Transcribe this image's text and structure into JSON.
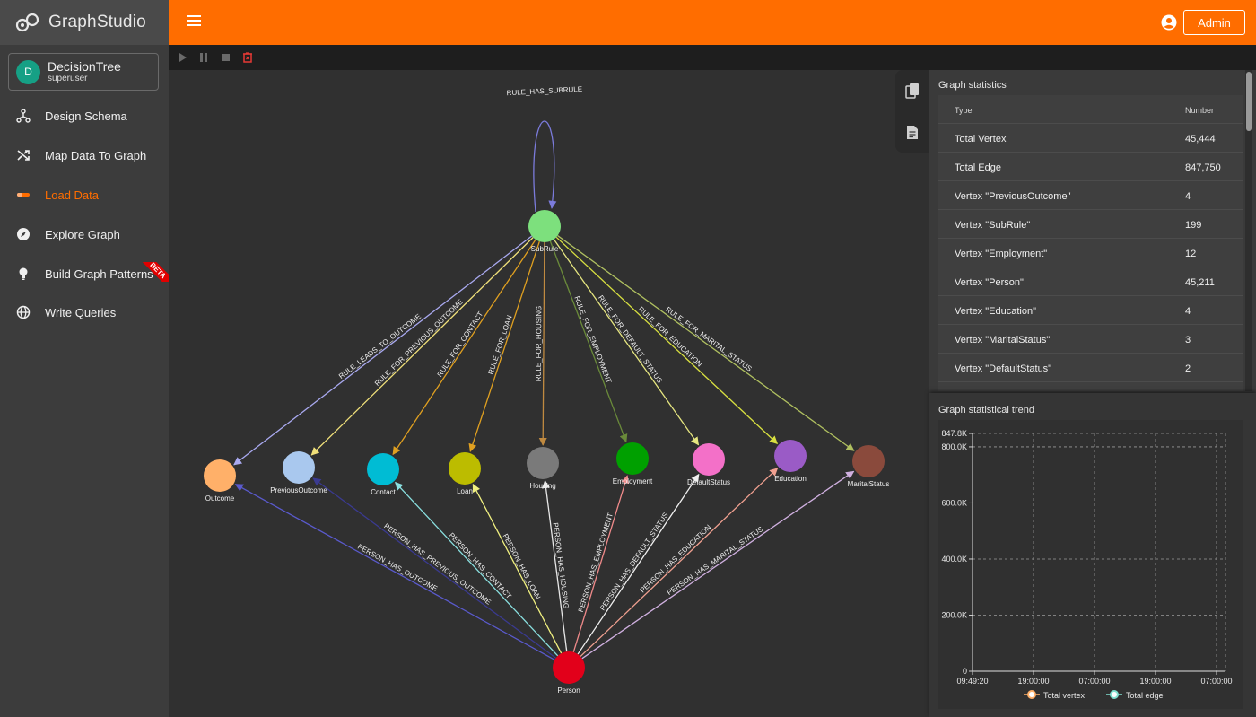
{
  "app": {
    "brand_prefix": "Graph",
    "brand_suffix": "Studio"
  },
  "user": {
    "initial": "D",
    "name": "DecisionTree",
    "role": "superuser"
  },
  "nav": [
    {
      "label": "Design Schema",
      "icon": "schema-icon",
      "active": false
    },
    {
      "label": "Map Data To Graph",
      "icon": "shuffle-icon",
      "active": false
    },
    {
      "label": "Load Data",
      "icon": "load-bar-icon",
      "active": true
    },
    {
      "label": "Explore Graph",
      "icon": "compass-icon",
      "active": false
    },
    {
      "label": "Build Graph Patterns",
      "icon": "lightbulb-icon",
      "active": false
    },
    {
      "label": "Write Queries",
      "icon": "globe-icon",
      "active": false
    }
  ],
  "beta_label": "BETA",
  "topbar": {
    "admin_label": "Admin"
  },
  "colors": {
    "accent": "#ff6d00",
    "sidebar": "#3c3c3c",
    "canvas": "#303030"
  },
  "graph": {
    "nodes": [
      {
        "id": "SubRule",
        "label": "SubRule",
        "color": "#7de07d"
      },
      {
        "id": "Person",
        "label": "Person",
        "color": "#e2001a"
      },
      {
        "id": "Outcome",
        "label": "Outcome",
        "color": "#ffb069"
      },
      {
        "id": "PreviousOutcome",
        "label": "PreviousOutcome",
        "color": "#a9c8ee"
      },
      {
        "id": "Contact",
        "label": "Contact",
        "color": "#00bcd4"
      },
      {
        "id": "Loan",
        "label": "Loan",
        "color": "#bcbc00"
      },
      {
        "id": "Housing",
        "label": "Housing",
        "color": "#7a7a7a"
      },
      {
        "id": "Employment",
        "label": "Employment",
        "color": "#00a000"
      },
      {
        "id": "DefaultStatus",
        "label": "DefaultStatus",
        "color": "#f370c8"
      },
      {
        "id": "Education",
        "label": "Education",
        "color": "#9a5bc6"
      },
      {
        "id": "MaritalStatus",
        "label": "MaritalStatus",
        "color": "#8a4a3c"
      }
    ],
    "edges": [
      {
        "from": "SubRule",
        "to": "SubRule",
        "label": "RULE_HAS_SUBRULE",
        "color": "#7b7bdb"
      },
      {
        "from": "SubRule",
        "to": "Outcome",
        "label": "RULE_LEADS_TO_OUTCOME",
        "color": "#a9a9f0"
      },
      {
        "from": "SubRule",
        "to": "PreviousOutcome",
        "label": "RULE_FOR_PREVIOUS_OUTCOME",
        "color": "#f0e07a"
      },
      {
        "from": "SubRule",
        "to": "Contact",
        "label": "RULE_FOR_CONTACT",
        "color": "#e0a020"
      },
      {
        "from": "SubRule",
        "to": "Loan",
        "label": "RULE_FOR_LOAN",
        "color": "#e0a020"
      },
      {
        "from": "SubRule",
        "to": "Housing",
        "label": "RULE_FOR_HOUSING",
        "color": "#c08a40"
      },
      {
        "from": "SubRule",
        "to": "Employment",
        "label": "RULE_FOR_EMPLOYMENT",
        "color": "#6a8a3a"
      },
      {
        "from": "SubRule",
        "to": "DefaultStatus",
        "label": "RULE_FOR_DEFAULT_STATUS",
        "color": "#e6e680"
      },
      {
        "from": "SubRule",
        "to": "Education",
        "label": "RULE_FOR_EDUCATION",
        "color": "#d8e040"
      },
      {
        "from": "SubRule",
        "to": "MaritalStatus",
        "label": "RULE_FOR_MARITAL_STATUS",
        "color": "#b0c060"
      },
      {
        "from": "Person",
        "to": "Outcome",
        "label": "PERSON_HAS_OUTCOME",
        "color": "#5a5acd"
      },
      {
        "from": "Person",
        "to": "PreviousOutcome",
        "label": "PERSON_HAS_PREVIOUS_OUTCOME",
        "color": "#3a3a90"
      },
      {
        "from": "Person",
        "to": "Contact",
        "label": "PERSON_HAS_CONTACT",
        "color": "#8ae0e0"
      },
      {
        "from": "Person",
        "to": "Loan",
        "label": "PERSON_HAS_LOAN",
        "color": "#f0f080"
      },
      {
        "from": "Person",
        "to": "Housing",
        "label": "PERSON_HAS_HOUSING",
        "color": "#e8e8e8"
      },
      {
        "from": "Person",
        "to": "Employment",
        "label": "PERSON_HAS_EMPLOYMENT",
        "color": "#f08a8a"
      },
      {
        "from": "Person",
        "to": "DefaultStatus",
        "label": "PERSON_HAS_DEFAULT_STATUS",
        "color": "#f0f0f0"
      },
      {
        "from": "Person",
        "to": "Education",
        "label": "PERSON_HAS_EDUCATION",
        "color": "#f0a090"
      },
      {
        "from": "Person",
        "to": "MaritalStatus",
        "label": "PERSON_HAS_MARITAL_STATUS",
        "color": "#d0b0e0"
      }
    ]
  },
  "stats": {
    "title": "Graph statistics",
    "headers": [
      "Type",
      "Number"
    ],
    "rows": [
      [
        "Total Vertex",
        "45,444"
      ],
      [
        "Total Edge",
        "847,750"
      ],
      [
        "Vertex \"PreviousOutcome\"",
        "4"
      ],
      [
        "Vertex \"SubRule\"",
        "199"
      ],
      [
        "Vertex \"Employment\"",
        "12"
      ],
      [
        "Vertex \"Person\"",
        "45,211"
      ],
      [
        "Vertex \"Education\"",
        "4"
      ],
      [
        "Vertex \"MaritalStatus\"",
        "3"
      ],
      [
        "Vertex \"DefaultStatus\"",
        "2"
      ]
    ]
  },
  "trend": {
    "title": "Graph statistical trend"
  },
  "chart_data": {
    "type": "line",
    "x": [
      "09:49:20",
      "19:00:00",
      "07:00:00",
      "19:00:00",
      "07:00:00"
    ],
    "y_ticks": [
      "0",
      "200.0K",
      "400.0K",
      "600.0K",
      "800.0K",
      "847.8K"
    ],
    "y_tick_values": [
      0,
      200000,
      400000,
      600000,
      800000,
      847800
    ],
    "ylim": [
      0,
      847800
    ],
    "grid": true,
    "legend": "bottom",
    "series": [
      {
        "name": "Total vertex",
        "color": "#ffb069",
        "values": []
      },
      {
        "name": "Total edge",
        "color": "#80e0d0",
        "values": []
      }
    ]
  }
}
